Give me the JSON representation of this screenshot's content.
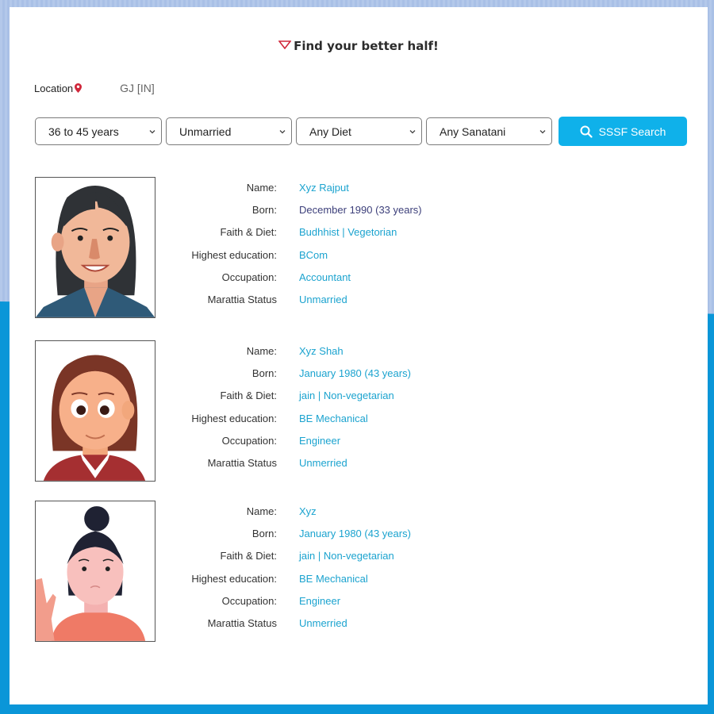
{
  "header": {
    "title": "Find your better half!"
  },
  "location": {
    "label": "Location",
    "value": "GJ [IN]"
  },
  "filters": {
    "age": "36 to 45 years",
    "marital": "Unmarried",
    "diet": "Any Diet",
    "sect": "Any Sanatani",
    "search_label": "SSSF Search"
  },
  "labels": {
    "name": "Name:",
    "born": "Born:",
    "faith": "Faith & Diet:",
    "education": "Highest education:",
    "occupation": "Occupation:",
    "status": "Marattia Status"
  },
  "profiles": [
    {
      "name": "Xyz Rajput",
      "born": "December 1990 (33 years)",
      "faith": "Budhhist | Vegetorian",
      "education": "BCom",
      "occupation": "Accountant",
      "status": "Unmarried"
    },
    {
      "name": "Xyz Shah",
      "born": "January 1980 (43 years)",
      "faith": "jain | Non-vegetarian",
      "education": "BE Mechanical",
      "occupation": "Engineer",
      "status": "Unmerried"
    },
    {
      "name": "Xyz",
      "born": "January 1980 (43 years)",
      "faith": "jain | Non-vegetarian",
      "education": "BE Mechanical",
      "occupation": "Engineer",
      "status": "Unmerried"
    }
  ],
  "colors": {
    "accent": "#0fb1ea",
    "value_text": "#1ba3cf",
    "pin": "#d0263a",
    "bg_bottom": "#0a96d8"
  }
}
